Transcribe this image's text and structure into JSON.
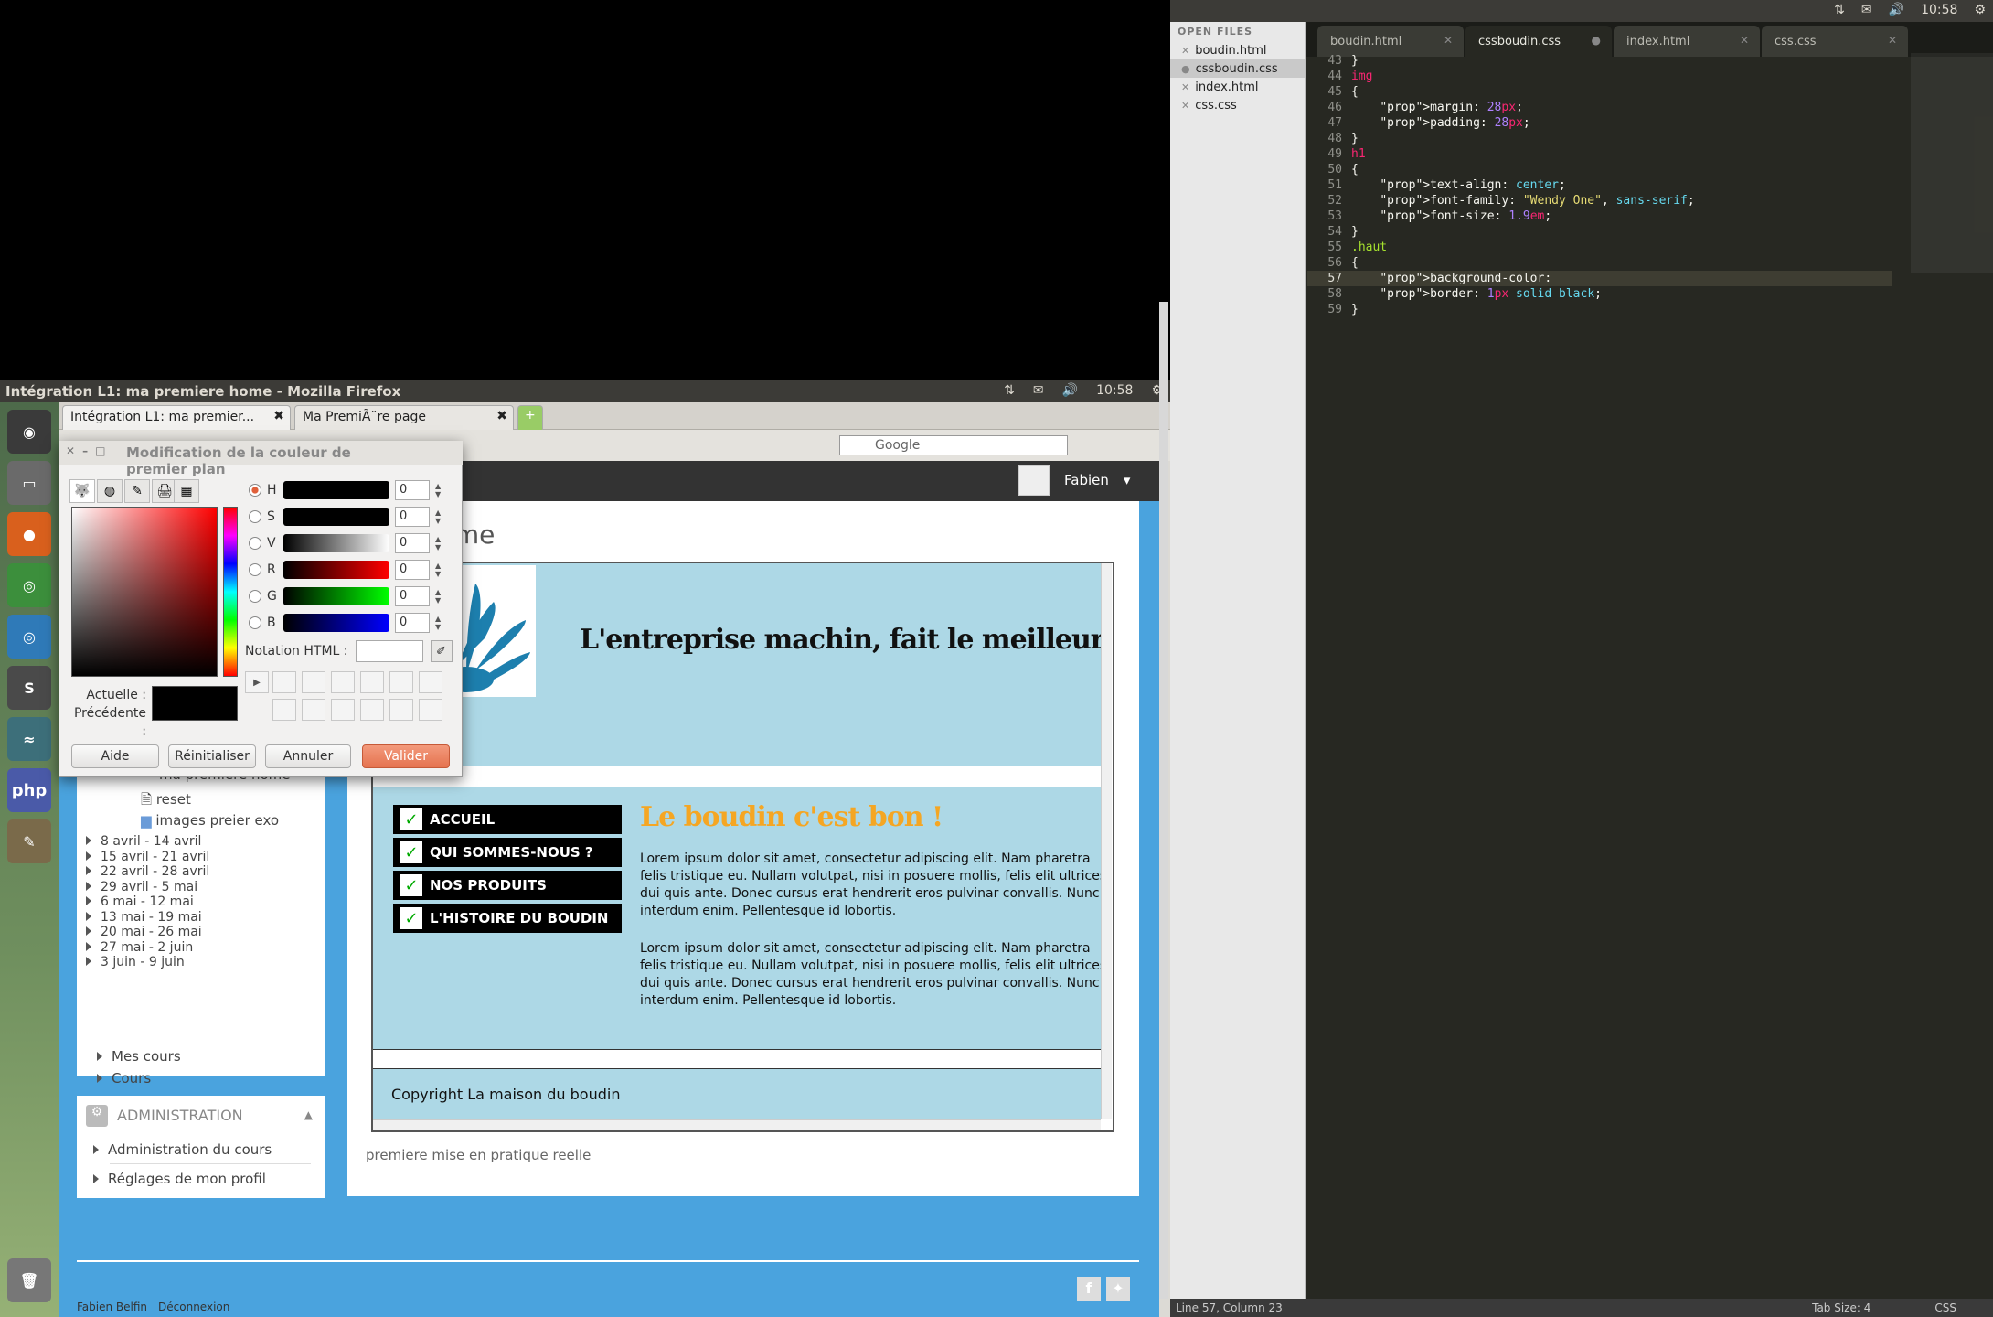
{
  "editor": {
    "clock": "10:58",
    "sidebar": {
      "header": "OPEN FILES",
      "files": [
        "boudin.html",
        "cssboudin.css",
        "index.html",
        "css.css"
      ]
    },
    "tabs": [
      "boudin.html",
      "cssboudin.css",
      "index.html",
      "css.css"
    ],
    "code": [
      {
        "n": "43",
        "t": "}"
      },
      {
        "n": "44",
        "t": "img"
      },
      {
        "n": "45",
        "t": "{"
      },
      {
        "n": "46",
        "t": "    margin: 28px;"
      },
      {
        "n": "47",
        "t": "    padding: 28px;"
      },
      {
        "n": "48",
        "t": "}"
      },
      {
        "n": "49",
        "t": "h1"
      },
      {
        "n": "50",
        "t": "{"
      },
      {
        "n": "51",
        "t": "    text-align: center;"
      },
      {
        "n": "52",
        "t": "    font-family: \"Wendy One\", sans-serif;"
      },
      {
        "n": "53",
        "t": "    font-size: 1.9em;"
      },
      {
        "n": "54",
        "t": "}"
      },
      {
        "n": "55",
        "t": ".haut"
      },
      {
        "n": "56",
        "t": "{"
      },
      {
        "n": "57",
        "t": "    background-color:"
      },
      {
        "n": "58",
        "t": "    border: 1px solid black;"
      },
      {
        "n": "59",
        "t": "}"
      }
    ],
    "status": {
      "position": "Line 57, Column 23",
      "tab_size": "Tab Size: 4",
      "syntax": "CSS"
    }
  },
  "firefox": {
    "title": "Intégration L1: ma premiere home - Mozilla Firefox",
    "clock": "10:58",
    "tabs": [
      "Intégration L1: ma premier...",
      "Ma PremiÃ¨re page"
    ],
    "search_placeholder": "Google",
    "user_name": "Fabien",
    "page_heading": "iere home",
    "tree": {
      "partial_item": "ma premiere home",
      "files": [
        "reset",
        "images preier exo"
      ],
      "weeks": [
        "8 avril - 14 avril",
        "15 avril - 21 avril",
        "22 avril - 28 avril",
        "29 avril - 5 mai",
        "6 mai - 12 mai",
        "13 mai - 19 mai",
        "20 mai - 26 mai",
        "27 mai - 2 juin",
        "3 juin - 9 juin"
      ],
      "mes_cours": "Mes cours",
      "cours": "Cours"
    },
    "admin": {
      "title": "ADMINISTRATION",
      "items": [
        "Administration du cours",
        "Réglages de mon profil"
      ]
    },
    "preview": {
      "h1": "L'entreprise machin, fait le meilleur bo",
      "nav": [
        "ACCUEIL",
        "QUI SOMMES-NOUS ?",
        "NOS PRODUITS",
        "L'HISTOIRE DU BOUDIN"
      ],
      "h2": "Le boudin c'est bon !",
      "paragraph_lines": [
        "Lorem ipsum dolor sit amet, consectetur adipiscing elit. Nam pharetra",
        "felis tristique eu. Nullam volutpat, nisi in posuere mollis, felis elit ultrices",
        "dui quis ante. Donec cursus erat hendrerit eros pulvinar convallis. Nunc",
        "interdum enim. Pellentesque id lobortis."
      ],
      "footer": "Copyright La maison du boudin"
    },
    "caption": "premiere mise en pratique reelle",
    "footer_links": [
      "Fabien Belfin",
      "Déconnexion"
    ]
  },
  "dialog": {
    "title": "Modification de la couleur de premier plan",
    "channels": [
      {
        "label": "H",
        "value": "0",
        "bar": "linear-gradient(to right,#000,#000)"
      },
      {
        "label": "S",
        "value": "0",
        "bar": "linear-gradient(to right,#000,#000)"
      },
      {
        "label": "V",
        "value": "0",
        "bar": "linear-gradient(to right,#000,#fff)"
      },
      {
        "label": "R",
        "value": "0",
        "bar": "linear-gradient(to right,#000,#f00)"
      },
      {
        "label": "G",
        "value": "0",
        "bar": "linear-gradient(to right,#000,#0f0)"
      },
      {
        "label": "B",
        "value": "0",
        "bar": "linear-gradient(to right,#000,#00f)"
      }
    ],
    "html_label": "Notation HTML :",
    "current_label": "Actuelle :",
    "previous_label": "Précédente :",
    "buttons": {
      "help": "Aide",
      "reset": "Réinitialiser",
      "cancel": "Annuler",
      "ok": "Valider"
    }
  }
}
